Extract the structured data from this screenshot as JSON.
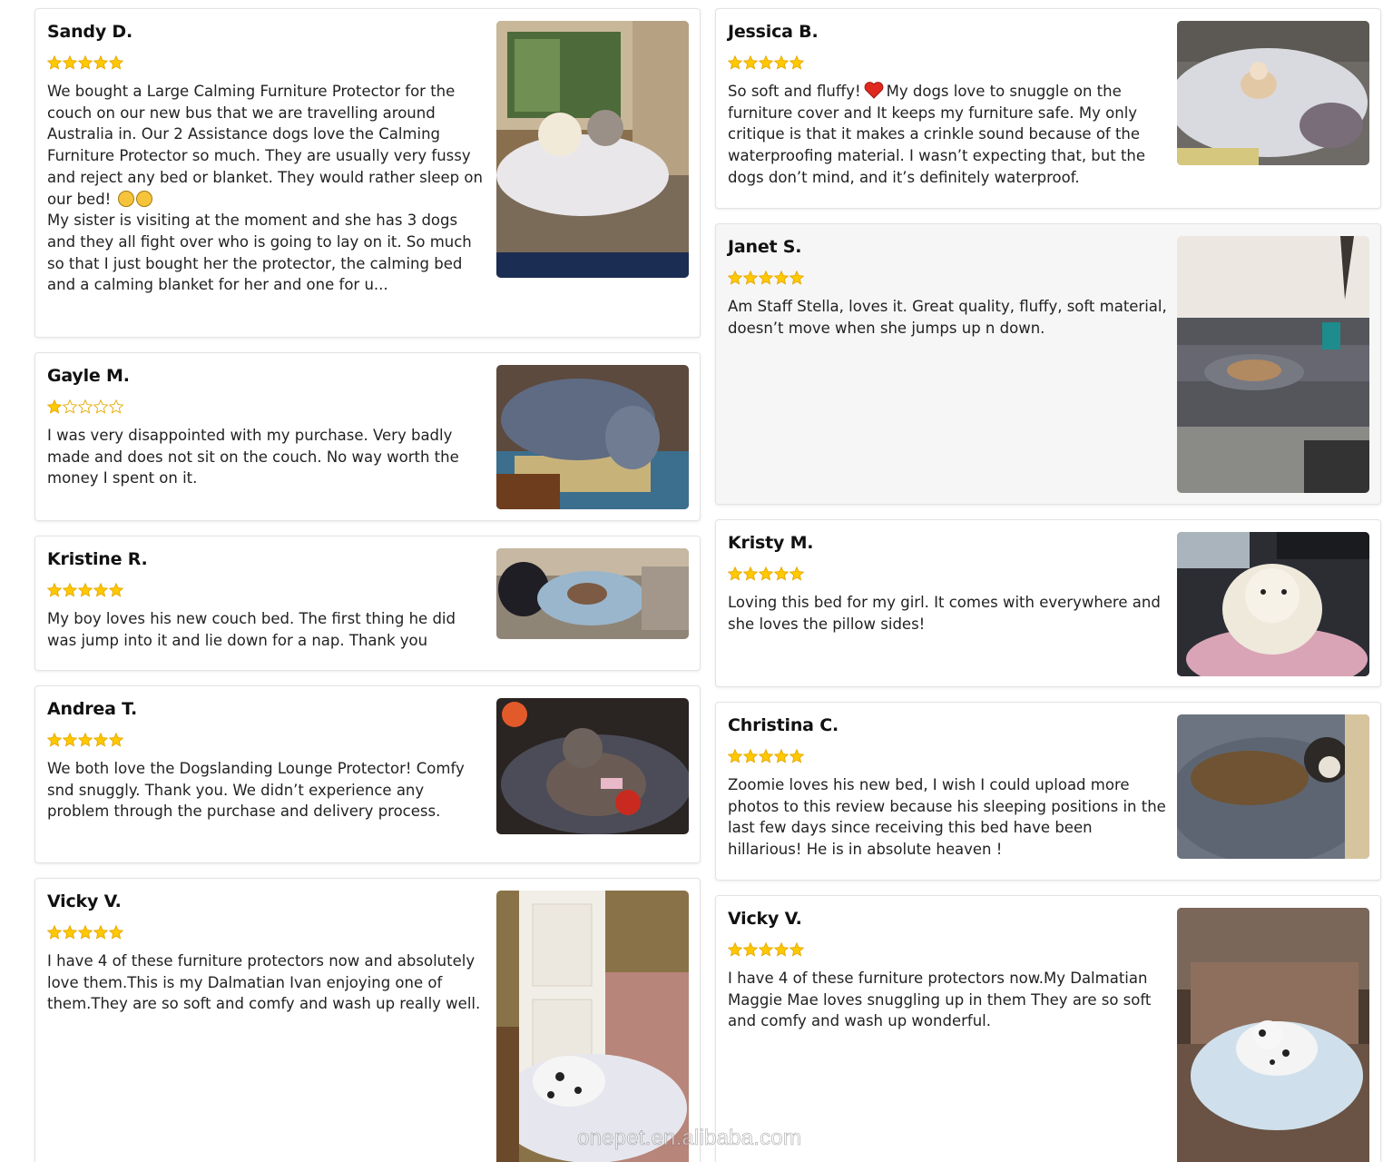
{
  "colors": {
    "star_gold": "#ffc800",
    "star_outline": "#e6a800",
    "card_border": "#e3e3e3"
  },
  "watermark": "onepet.en.alibaba.com",
  "reviews_left": [
    {
      "name": "Sandy D.",
      "rating": 5,
      "text": "We bought a Large Calming Furniture Protector for the couch on our new bus that we are travelling around Australia in. Our 2 Assistance dogs love the Calming Furniture Protector so much. They are usually very fussy and reject any bed or blanket. They would rather sleep on our bed!",
      "text2": "My sister is visiting at the moment and she has 3 dogs and they all fight over who is going to lay on it. So much so that I just bought her the protector, the calming bed and a calming blanket for her and one for u...",
      "photo": "dogs-on-bus-couch"
    },
    {
      "name": "Gayle M.",
      "rating": 1,
      "text": "I was very disappointed with my purchase. Very badly made and does not sit on the couch. No way worth the money I spent on it.",
      "photo": "grey-furniture-protector"
    },
    {
      "name": "Kristine R.",
      "rating": 5,
      "text": "My boy loves his new couch bed. The first thing he did was jump into it and lie down for a nap. Thank you",
      "photo": "dog-napping-on-couch-bed"
    },
    {
      "name": "Andrea T.",
      "rating": 5,
      "text": "We both love the Dogslanding Lounge Protector! Comfy snd snuggly. Thank you. We didn’t experience any problem through the purchase and delivery process.",
      "photo": "pitbull-on-lounge-protector"
    },
    {
      "name": "Vicky V.",
      "rating": 5,
      "text": "I have 4 of these furniture protectors now and absolutely love them.This is my Dalmatian Ivan enjoying one of them.They are so soft and comfy and wash up really well.",
      "photo": "dalmatian-ivan-on-protector"
    }
  ],
  "reviews_right": [
    {
      "name": "Jessica B.",
      "rating": 5,
      "text_a": "So soft and fluffy!",
      "text_b": "My dogs love to snuggle on the furniture cover and It keeps my furniture safe. My only critique is that it makes a crinkle sound because of the waterproofing material. I wasn’t expecting that, but the dogs don’t mind, and it’s definitely waterproof.",
      "photo": "chihuahua-on-fluffy-cover"
    },
    {
      "name": "Janet S.",
      "rating": 5,
      "text": "Am Staff Stella, loves it.  Great quality, fluffy, soft material, doesn’t move when she jumps up n down.",
      "photo": "amstaff-on-sectional-sofa"
    },
    {
      "name": "Kristy M.",
      "rating": 5,
      "text": "Loving this bed for my girl.  It comes with everywhere and she loves the pillow sides!",
      "photo": "white-dog-in-car"
    },
    {
      "name": "Christina C.",
      "rating": 5,
      "text": "Zoomie loves his new bed, I wish I could upload more photos to this review because his sleeping positions in the last few days since receiving this bed have been hillarious! He is in absolute heaven !",
      "photo": "brindle-dog-sleeping"
    },
    {
      "name": "Vicky V.",
      "rating": 5,
      "text": "I have 4 of these furniture protectors now.My Dalmatian Maggie Mae loves snuggling up in them They are so soft and comfy and wash up wonderful.",
      "photo": "dalmatian-maggie-mae-on-protector"
    }
  ]
}
